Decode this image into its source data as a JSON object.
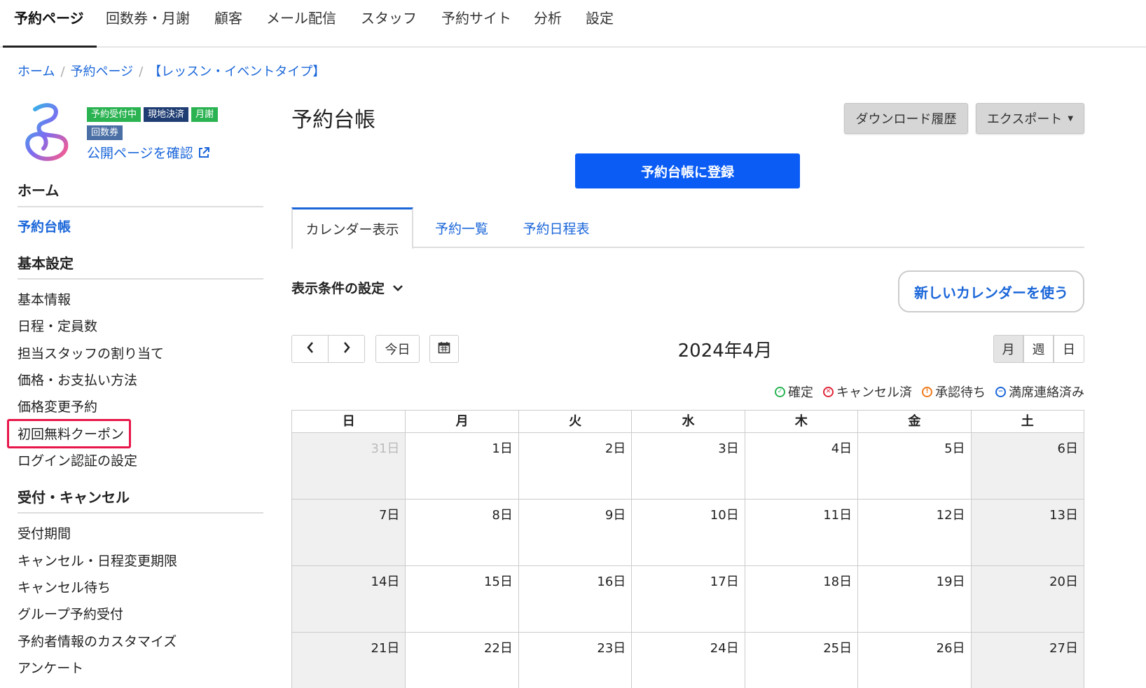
{
  "topnav": {
    "items": [
      "予約ページ",
      "回数券・月謝",
      "顧客",
      "メール配信",
      "スタッフ",
      "予約サイト",
      "分析",
      "設定"
    ]
  },
  "breadcrumb": {
    "home": "ホーム",
    "booking": "予約ページ",
    "current": "【レッスン・イベントタイプ】"
  },
  "badges": [
    {
      "label": "予約受付中",
      "color": "#2bb352"
    },
    {
      "label": "現地決済",
      "color": "#1f3d73"
    },
    {
      "label": "月謝",
      "color": "#2bb352"
    },
    {
      "label": "回数券",
      "color": "#4a6fa5"
    }
  ],
  "public_link": "公開ページを確認",
  "sidebar": {
    "home_head": "ホーム",
    "ledger_link": "予約台帳",
    "basic_head": "基本設定",
    "basic_items": [
      "基本情報",
      "日程・定員数",
      "担当スタッフの割り当て",
      "価格・お支払い方法",
      "価格変更予約",
      "初回無料クーポン",
      "ログイン認証の設定"
    ],
    "reception_head": "受付・キャンセル",
    "reception_items": [
      "受付期間",
      "キャンセル・日程変更期限",
      "キャンセル待ち",
      "グループ予約受付",
      "予約者情報のカスタマイズ",
      "アンケート"
    ]
  },
  "main": {
    "title": "予約台帳",
    "download_history": "ダウンロード履歴",
    "export": "エクスポート",
    "register": "予約台帳に登録",
    "tabs": [
      "カレンダー表示",
      "予約一覧",
      "予約日程表"
    ],
    "conditions": "表示条件の設定",
    "new_calendar": "新しいカレンダーを使う",
    "today": "今日",
    "month_title": "2024年4月",
    "views": [
      "月",
      "週",
      "日"
    ],
    "legend": [
      {
        "label": "確定",
        "color": "#2bb352",
        "icon": "check-icon"
      },
      {
        "label": "キャンセル済",
        "color": "#e0263a",
        "icon": "cancel-icon"
      },
      {
        "label": "承認待ち",
        "color": "#f07a1a",
        "icon": "pending-icon"
      },
      {
        "label": "満席連絡済み",
        "color": "#1a66d9",
        "icon": "full-icon"
      }
    ]
  },
  "calendar": {
    "weekdays": [
      "日",
      "月",
      "火",
      "水",
      "木",
      "金",
      "土"
    ],
    "weeks": [
      [
        "31日",
        "1日",
        "2日",
        "3日",
        "4日",
        "5日",
        "6日"
      ],
      [
        "7日",
        "8日",
        "9日",
        "10日",
        "11日",
        "12日",
        "13日"
      ],
      [
        "14日",
        "15日",
        "16日",
        "17日",
        "18日",
        "19日",
        "20日"
      ],
      [
        "21日",
        "22日",
        "23日",
        "24日",
        "25日",
        "26日",
        "27日"
      ]
    ]
  }
}
